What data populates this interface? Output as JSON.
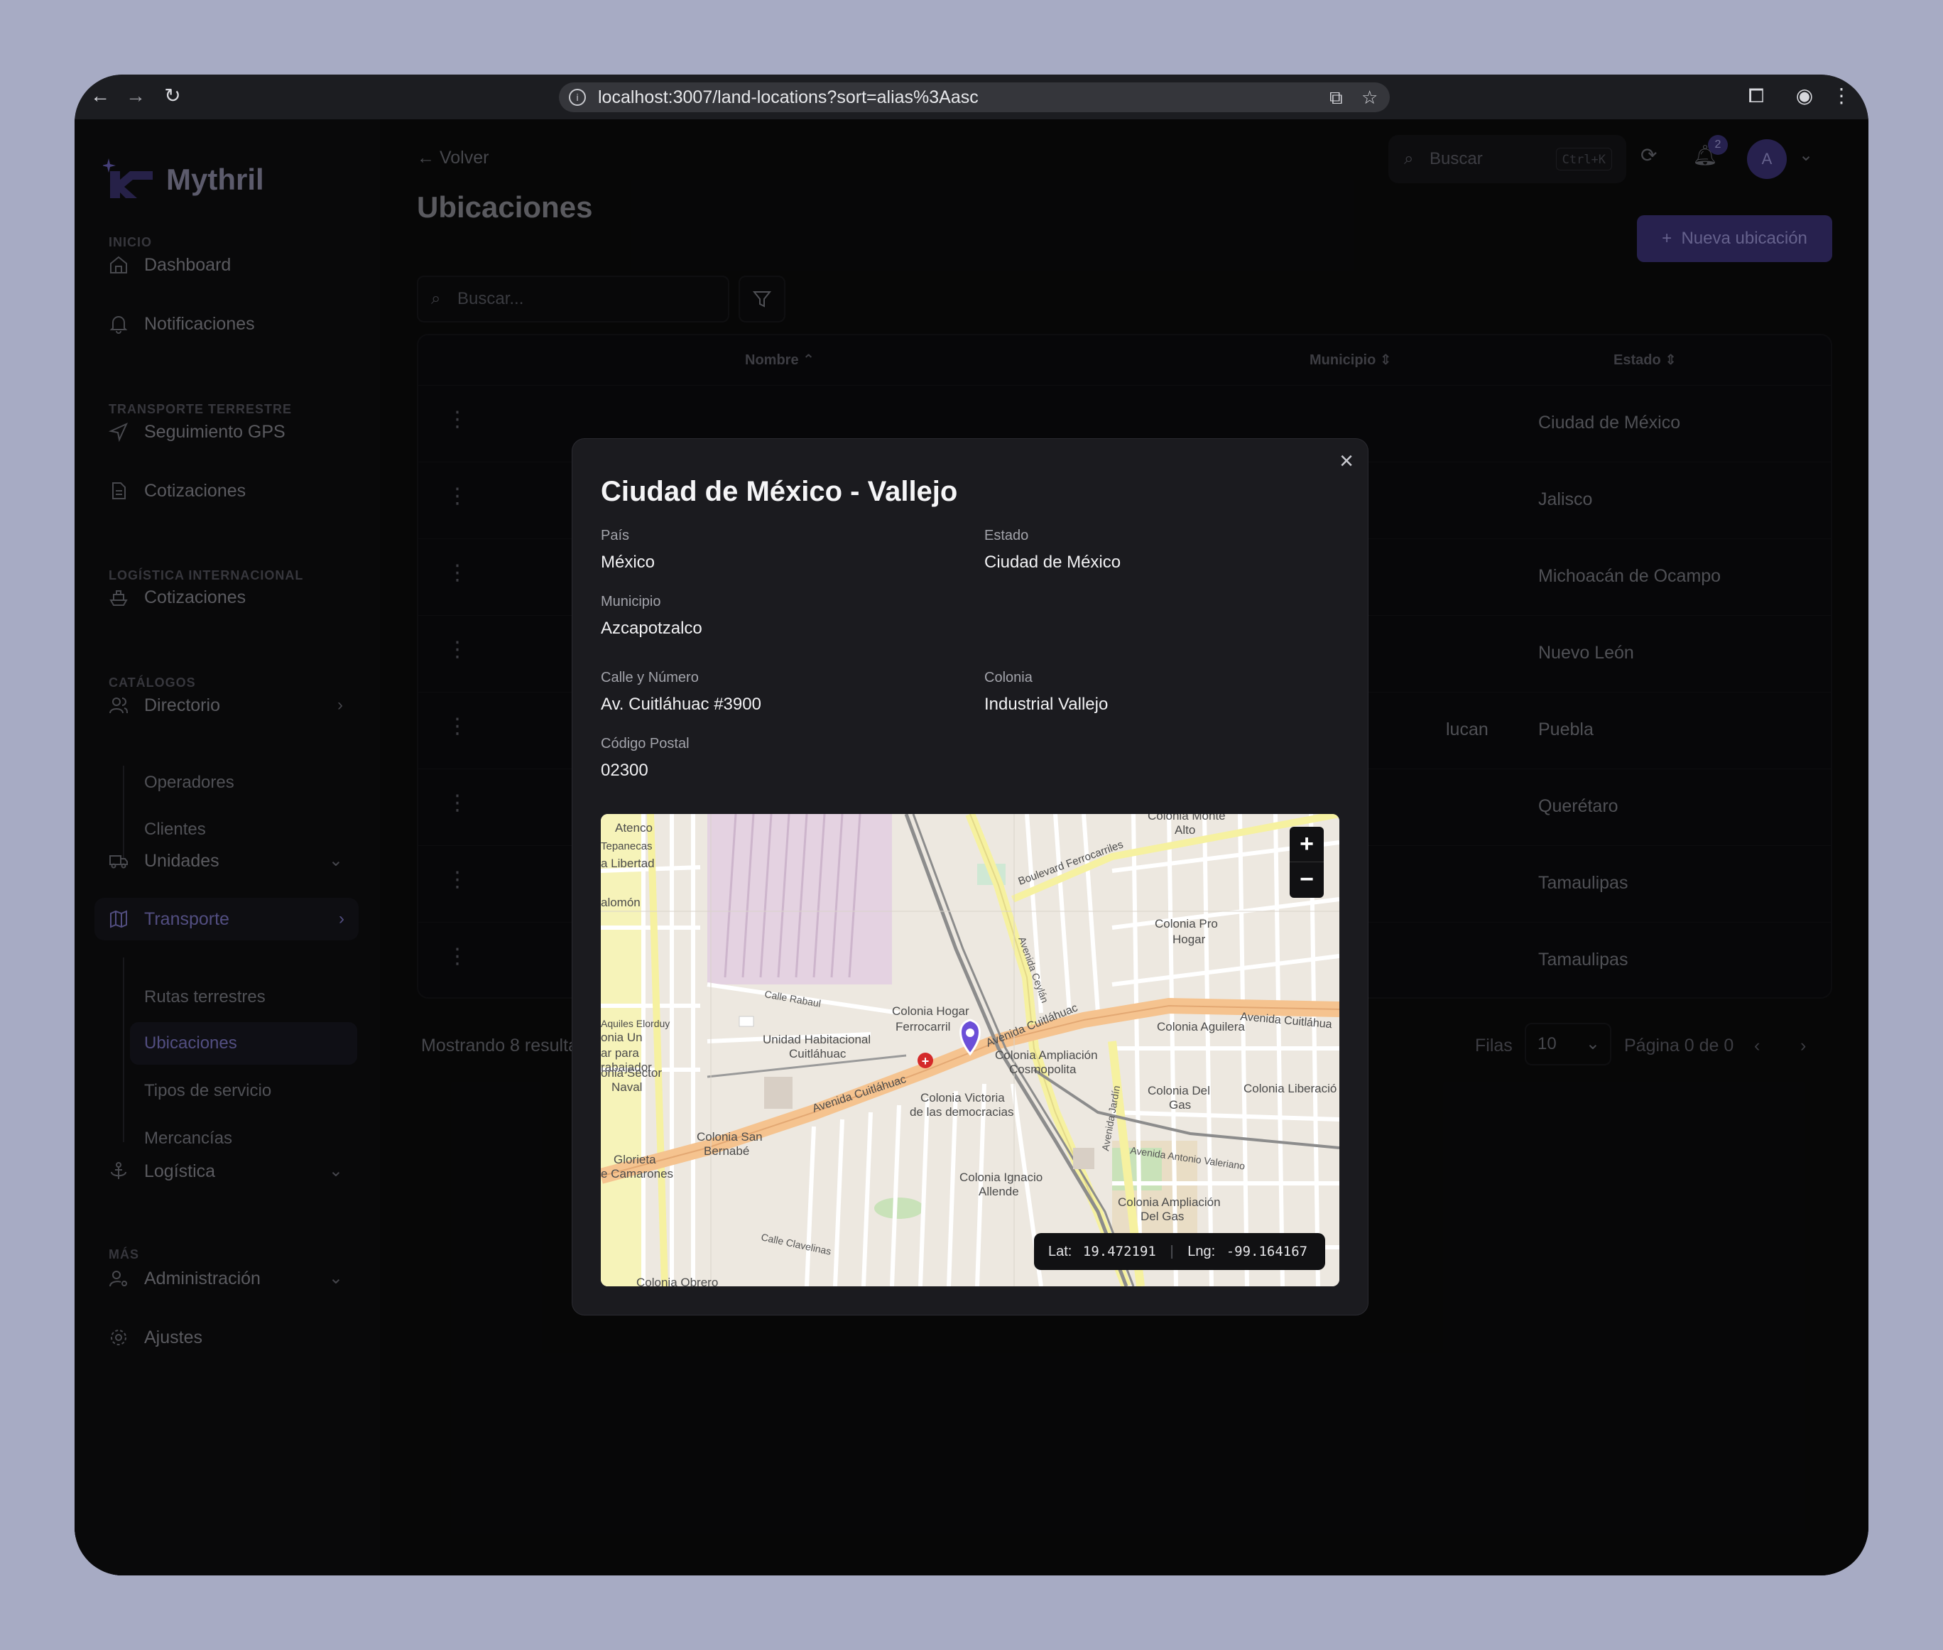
{
  "browser": {
    "url": "localhost:3007/land-locations?sort=alias%3Aasc"
  },
  "brand": {
    "name": "Mythril",
    "accent": "#3c3478"
  },
  "sidebar": {
    "sections": {
      "inicio": "INICIO",
      "transporte_terrestre": "TRANSPORTE TERRESTRE",
      "logistica_internacional": "LOGÍSTICA INTERNACIONAL",
      "catalogos": "CATÁLOGOS",
      "mas": "MÁS"
    },
    "items": {
      "dashboard": "Dashboard",
      "notificaciones": "Notificaciones",
      "seguimiento_gps": "Seguimiento GPS",
      "cotizaciones_tt": "Cotizaciones",
      "cotizaciones_li": "Cotizaciones",
      "directorio": "Directorio",
      "operadores": "Operadores",
      "clientes": "Clientes",
      "unidades": "Unidades",
      "transporte": "Transporte",
      "rutas_terrestres": "Rutas terrestres",
      "ubicaciones": "Ubicaciones",
      "tipos_de_servicio": "Tipos de servicio",
      "mercancias": "Mercancías",
      "logistica": "Logística",
      "administracion": "Administración",
      "ajustes": "Ajustes"
    }
  },
  "header": {
    "back_label": "Volver",
    "search_placeholder": "Buscar",
    "search_shortcut": "Ctrl+K",
    "notification_count": "2",
    "avatar_initial": "A"
  },
  "page": {
    "title": "Ubicaciones",
    "new_button": "Nueva ubicación",
    "search_placeholder": "Buscar..."
  },
  "table": {
    "columns": {
      "nombre": "Nombre",
      "municipio": "Municipio",
      "estado": "Estado"
    },
    "rows": [
      {
        "municipio": "",
        "estado": "Ciudad de México"
      },
      {
        "municipio": "",
        "estado": "Jalisco"
      },
      {
        "municipio": "",
        "estado": "Michoacán de Ocampo"
      },
      {
        "municipio": "",
        "estado": "Nuevo León"
      },
      {
        "municipio": "lucan",
        "estado": "Puebla"
      },
      {
        "municipio": "",
        "estado": "Querétaro"
      },
      {
        "municipio": "",
        "estado": "Tamaulipas"
      },
      {
        "municipio": "",
        "estado": "Tamaulipas"
      }
    ]
  },
  "footer": {
    "showing": "Mostrando 8 resulta",
    "rows_label": "Filas",
    "rows_value": "10",
    "page_label": "Página 0 de 0"
  },
  "modal": {
    "title": "Ciudad de México - Vallejo",
    "fields": {
      "pais_label": "País",
      "pais": "México",
      "estado_label": "Estado",
      "estado": "Ciudad de México",
      "municipio_label": "Municipio",
      "municipio": "Azcapotzalco",
      "calle_label": "Calle y Número",
      "calle": "Av. Cuitláhuac #3900",
      "colonia_label": "Colonia",
      "colonia": "Industrial Vallejo",
      "cp_label": "Código Postal",
      "cp": "02300"
    },
    "map": {
      "lat_label": "Lat:",
      "lat": "19.472191",
      "lng_label": "Lng:",
      "lng": "-99.164167",
      "zoom_in": "+",
      "zoom_out": "−",
      "labels": {
        "atenco": "Atenco",
        "tepanecas": "Tepanecas",
        "libertad": "a Libertad",
        "salomon": "alomón",
        "colonia_monte_alto": "Colonia Monte",
        "alto": "Alto",
        "boulevard_ferrocarriles": "Boulevard Ferrocarriles",
        "colonia_pro_hogar": "Colonia Pro",
        "hogar": "Hogar",
        "colonia_hogar_ferrocarril": "Colonia Hogar",
        "ferrocarril": "Ferrocarril",
        "unidad_habitacional": "Unidad Habitacional",
        "cuitlahuac": "Cuitláhuac",
        "avenida_cuitlahuac": "Avenida Cuitláhuac",
        "avenida_cuitlahuac_2": "Avenida Cuitláhuac",
        "avenida_cuitlahuac_3": "Avenida Cuitláhua",
        "colonia_aguilera": "Colonia Aguilera",
        "colonia_ampliacion_cosmopolita": "Colonia Ampliación",
        "cosmopolita": "Cosmopolita",
        "colonia_victoria": "Colonia Victoria",
        "de_las_democracias": "de las democracias",
        "colonia_del_gas": "Colonia Del",
        "gas": "Gas",
        "colonia_liberacion": "Colonia Liberació",
        "colonia_san_bernabe": "Colonia San",
        "bernabe": "Bernabé",
        "glorieta": "Glorieta",
        "camarones": "e Camarones",
        "colonia_ignacio_allende": "Colonia Ignacio",
        "allende": "Allende",
        "colonia_ampliacion_del_gas": "Colonia Ampliación",
        "del_gas": "Del Gas",
        "colonia_obrero": "Colonia Obrero",
        "avenida_jardin": "Avenida Jardín",
        "calle_rabaul": "Calle Rabaul",
        "avenida_ceylan": "Avenida Ceylán",
        "avenida_antonio_valeriano": "Avenida Antonio Valeriano",
        "calle_clavelinas": "Calle Clavelinas",
        "naval": "Naval",
        "sector": "onia Sector",
        "aquiles": "Aquiles Elorduy",
        "onia_un": "onia Un",
        "par_para": "ar para",
        "trabajador": "rabajador"
      }
    }
  }
}
